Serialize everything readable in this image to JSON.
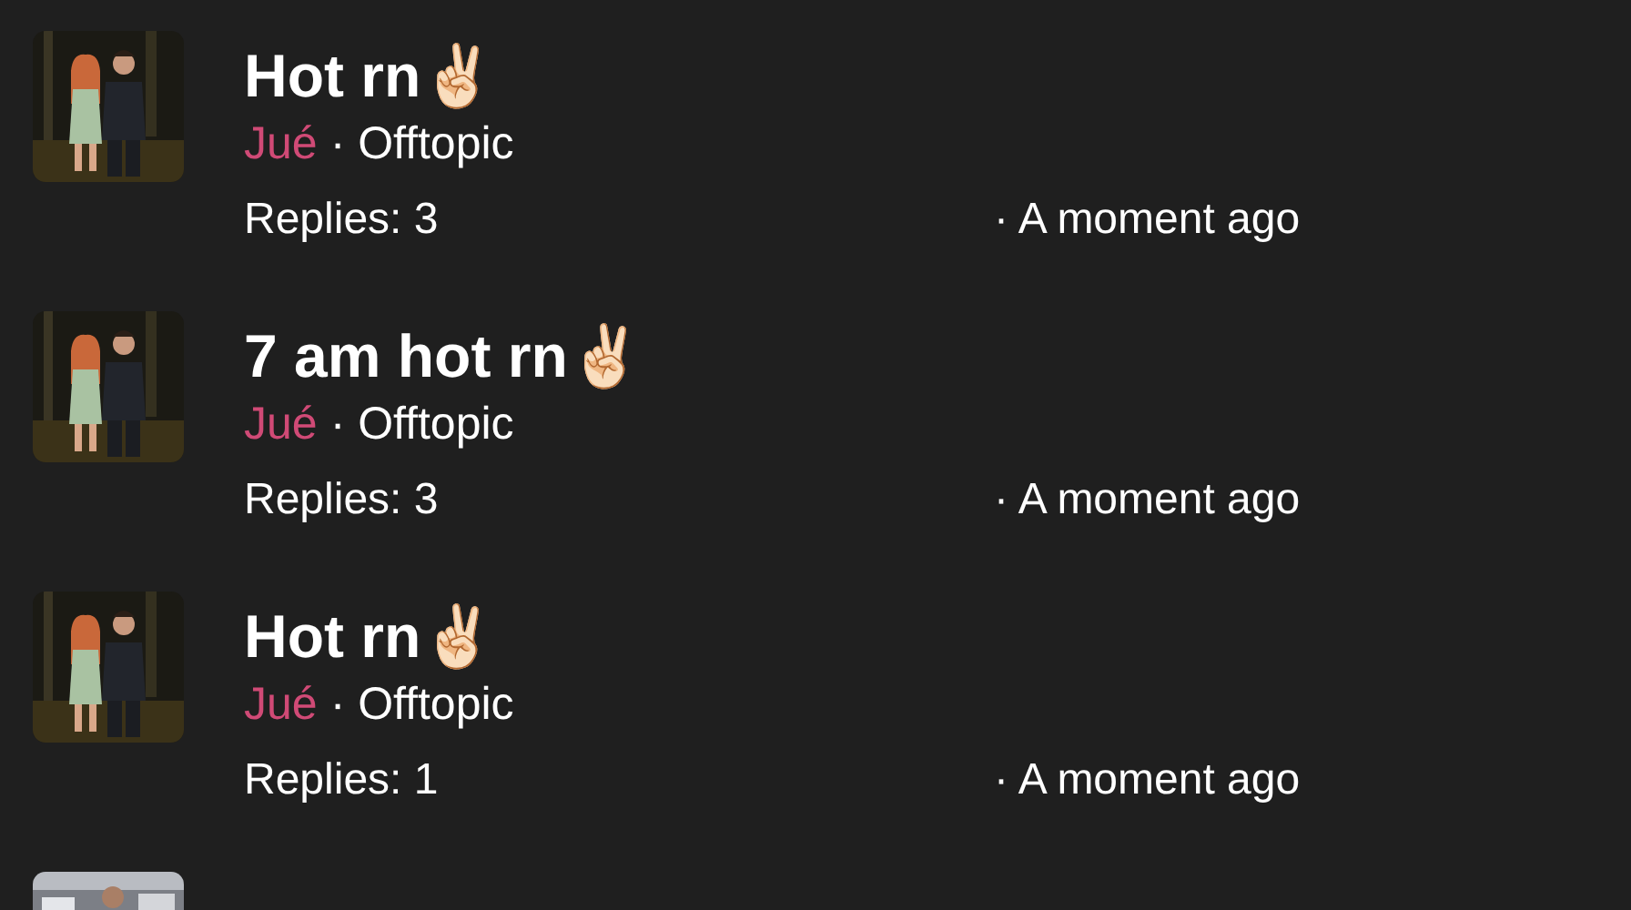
{
  "threads": [
    {
      "title": "Hot rn✌🏻",
      "author": "Jué",
      "category": "· Offtopic",
      "replies": "Replies: 3",
      "time": "· A moment ago",
      "avatar": {
        "kind": "picture"
      }
    },
    {
      "title": "7 am hot rn✌🏻",
      "author": "Jué",
      "category": "· Offtopic",
      "replies": "Replies: 3",
      "time": "· A moment ago",
      "avatar": {
        "kind": "picture"
      }
    },
    {
      "title": "Hot rn✌🏻",
      "author": "Jué",
      "category": "· Offtopic",
      "replies": "Replies: 1",
      "time": "· A moment ago",
      "avatar": {
        "kind": "picture"
      }
    },
    {
      "avatar": {
        "kind": "picture"
      }
    }
  ]
}
